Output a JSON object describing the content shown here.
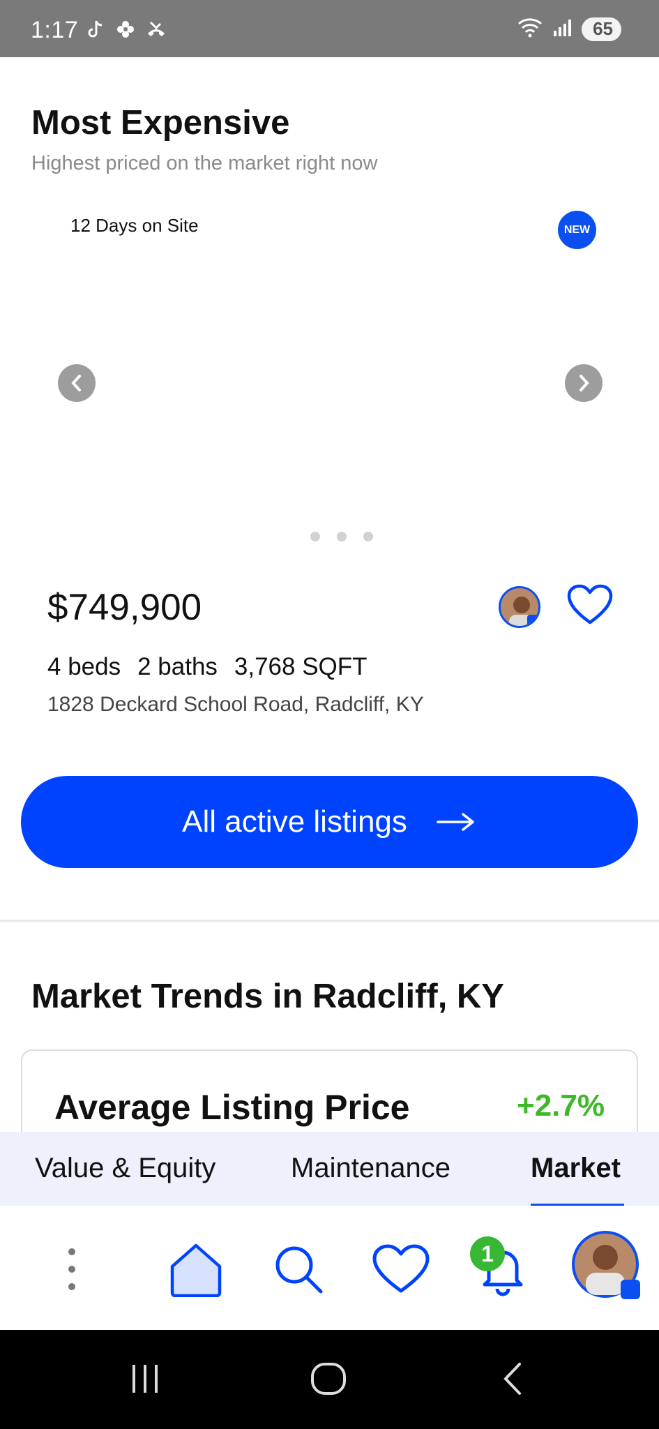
{
  "status_bar": {
    "time": "1:17",
    "battery": "65",
    "wifi_label": "6"
  },
  "most_expensive": {
    "title": "Most Expensive",
    "subtitle": "Highest priced on the market right now",
    "days_on_site": "12 Days on Site",
    "new_badge": "NEW",
    "price": "$749,900",
    "beds": "4 beds",
    "baths": "2 baths",
    "sqft": "3,768 SQFT",
    "address": "1828 Deckard School Road, Radcliff, KY",
    "cta_label": "All active listings"
  },
  "market_trends": {
    "title": "Market Trends in Radcliff, KY",
    "card_label": "Average Listing Price",
    "card_change": "+2.7%",
    "change_color": "#3db827"
  },
  "tabs": [
    {
      "label": "Value & Equity"
    },
    {
      "label": "Maintenance"
    },
    {
      "label": "Market"
    }
  ],
  "bottom_nav": {
    "notification_count": "1",
    "items": [
      "menu-icon",
      "home-icon",
      "search-icon",
      "heart-icon",
      "bell-icon",
      "profile-avatar"
    ]
  },
  "accent_color": "#0043ff"
}
